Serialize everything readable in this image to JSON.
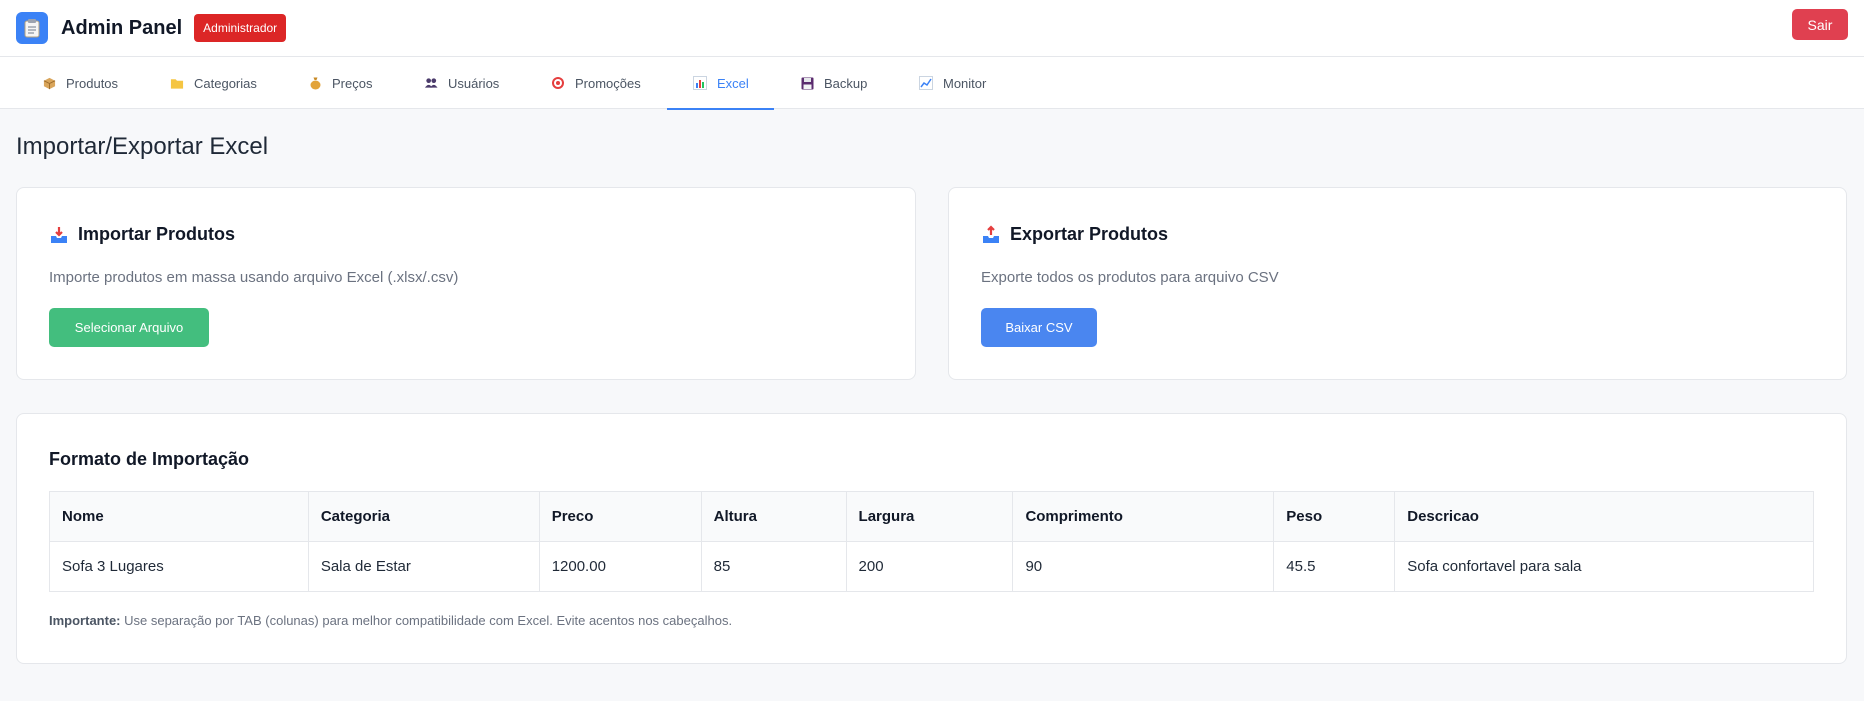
{
  "header": {
    "title": "Admin Panel",
    "role_badge": "Administrador",
    "logout_label": "Sair"
  },
  "tabs": [
    {
      "label": "Produtos",
      "icon": "box-icon"
    },
    {
      "label": "Categorias",
      "icon": "folder-icon"
    },
    {
      "label": "Preços",
      "icon": "money-bag-icon"
    },
    {
      "label": "Usuários",
      "icon": "users-icon"
    },
    {
      "label": "Promoções",
      "icon": "target-icon"
    },
    {
      "label": "Excel",
      "icon": "bar-chart-icon",
      "active": true
    },
    {
      "label": "Backup",
      "icon": "floppy-disk-icon"
    },
    {
      "label": "Monitor",
      "icon": "trend-chart-icon"
    }
  ],
  "page": {
    "title": "Importar/Exportar Excel"
  },
  "import_card": {
    "title": "Importar Produtos",
    "description": "Importe produtos em massa usando arquivo Excel (.xlsx/.csv)",
    "button_label": "Selecionar Arquivo"
  },
  "export_card": {
    "title": "Exportar Produtos",
    "description": "Exporte todos os produtos para arquivo CSV",
    "button_label": "Baixar CSV"
  },
  "format_card": {
    "title": "Formato de Importação",
    "columns": [
      "Nome",
      "Categoria",
      "Preco",
      "Altura",
      "Largura",
      "Comprimento",
      "Peso",
      "Descricao"
    ],
    "rows": [
      [
        "Sofa 3 Lugares",
        "Sala de Estar",
        "1200.00",
        "85",
        "200",
        "90",
        "45.5",
        "Sofa confortavel para sala"
      ]
    ],
    "note_label": "Importante:",
    "note_text": " Use separação por TAB (colunas) para melhor compatibilidade com Excel. Evite acentos nos cabeçalhos."
  },
  "colors": {
    "accent": "#3b82f6",
    "danger": "#dc2626",
    "success": "#43be7e"
  }
}
